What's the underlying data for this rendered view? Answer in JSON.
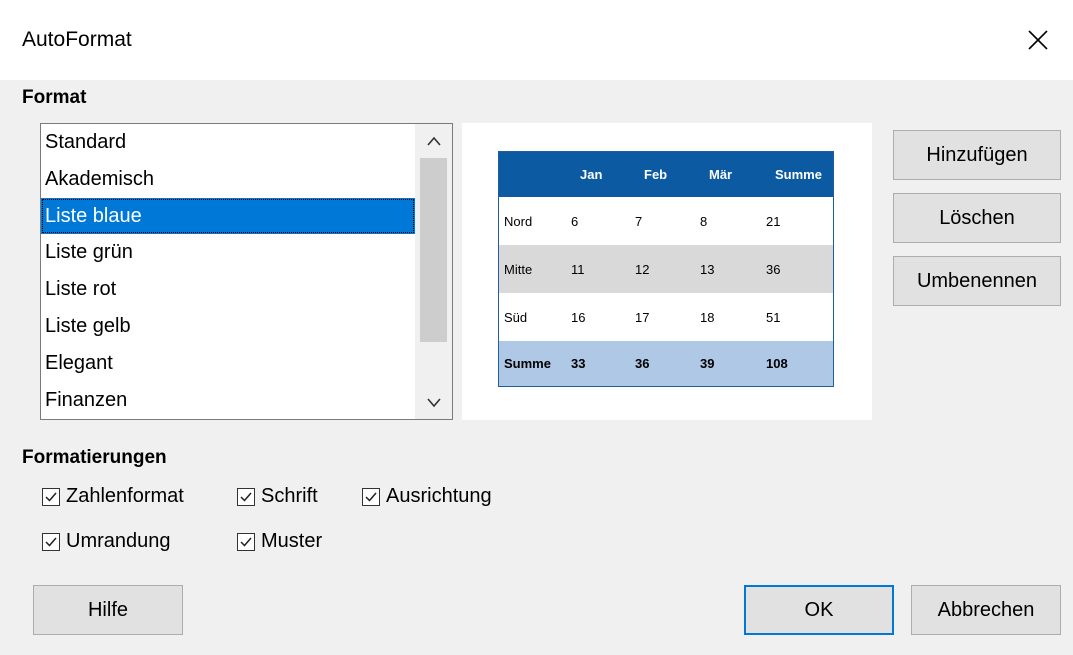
{
  "window": {
    "title": "AutoFormat"
  },
  "format_section": {
    "label": "Format"
  },
  "format_list": {
    "items": [
      "Standard",
      "Akademisch",
      "Liste blaue",
      "Liste grün",
      "Liste rot",
      "Liste gelb",
      "Elegant",
      "Finanzen"
    ],
    "selected": "Liste blaue"
  },
  "preview": {
    "header": [
      "",
      "Jan",
      "Feb",
      "Mär",
      "Summe"
    ],
    "rows": [
      [
        "Nord",
        "6",
        "7",
        "8",
        "21"
      ],
      [
        "Mitte",
        "11",
        "12",
        "13",
        "36"
      ],
      [
        "Süd",
        "16",
        "17",
        "18",
        "51"
      ]
    ],
    "total": [
      "Summe",
      "33",
      "36",
      "39",
      "108"
    ],
    "colors": {
      "header": "#0b5aa2",
      "alt_row": "#d9d9d9",
      "total": "#aec8e6"
    }
  },
  "buttons": {
    "add": "Hinzufügen",
    "delete": "Löschen",
    "rename": "Umbenennen",
    "help": "Hilfe",
    "ok": "OK",
    "cancel": "Abbrechen"
  },
  "formatting_section": {
    "label": "Formatierungen"
  },
  "options": {
    "number_format": {
      "label": "Zahlenformat",
      "checked": true
    },
    "font": {
      "label": "Schrift",
      "checked": true
    },
    "alignment": {
      "label": "Ausrichtung",
      "checked": true
    },
    "border": {
      "label": "Umrandung",
      "checked": true
    },
    "pattern": {
      "label": "Muster",
      "checked": true
    }
  },
  "icons": {
    "close": "close-icon",
    "scroll_up": "chevron-up-icon",
    "scroll_down": "chevron-down-icon",
    "checkmark": "checkmark-icon"
  },
  "accent_color": "#0078d7"
}
